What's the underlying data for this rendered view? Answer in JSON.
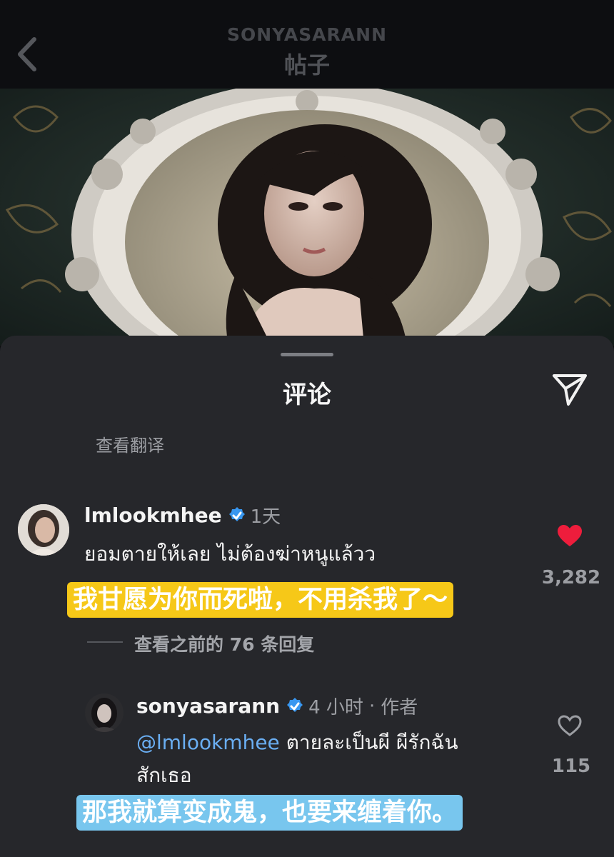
{
  "header": {
    "username": "SONYASARANN",
    "title": "帖子",
    "back_icon": "chevron-left-icon"
  },
  "photo": {
    "description_icon": "post-photo"
  },
  "comments_sheet": {
    "title": "评论",
    "share_icon": "send-icon",
    "see_translation": "查看翻译"
  },
  "comments": [
    {
      "username": "lmlookmhee",
      "verified": true,
      "time": "1天",
      "text": "ยอมตายให้เลย ไม่ต้องฆ่าหนูแล้วว",
      "translation": "我甘愿为你而死啦，不用杀我了～",
      "translation_color": "#f6c818",
      "liked": true,
      "like_count": "3,282",
      "view_replies": "查看之前的 76 条回复"
    }
  ],
  "reply": {
    "username": "sonyasarann",
    "verified": true,
    "time": "4 小时",
    "separator": "·",
    "author_label": "作者",
    "mention": "@lmlookmhee",
    "text_line1": "ตายละเป็นผี ผีรักฉัน",
    "text_line2": "สักเธอ",
    "translation": "那我就算变成鬼，也要来缠着你。",
    "translation_color": "#78c6ee",
    "liked": false,
    "like_count": "115"
  },
  "colors": {
    "accent_heart": "#ee1d3c",
    "verified_badge": "#3897f0",
    "mention": "#6aaef2"
  }
}
